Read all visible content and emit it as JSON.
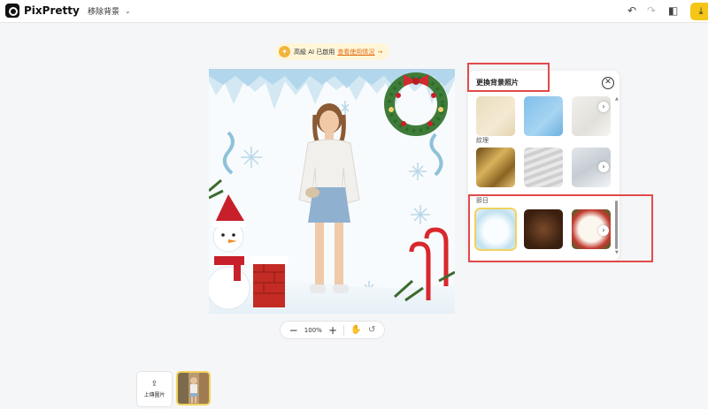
{
  "header": {
    "app_name": "PixPretty",
    "mode_label": "移除背景",
    "icons": [
      "undo-icon",
      "redo-icon",
      "compare-icon",
      "download-icon"
    ]
  },
  "promo": {
    "text": "高級 AI 已啟用",
    "link": "查看使用情況"
  },
  "zoom": {
    "value": "100%"
  },
  "panel": {
    "title": "更換背景照片",
    "sections": [
      {
        "label": "",
        "thumbs": [
          "beige-linen",
          "blue-paper",
          "white-fabric"
        ]
      },
      {
        "label": "紋理",
        "thumbs": [
          "gold-foil",
          "gray-wave",
          "white-silk"
        ]
      },
      {
        "label": "節日",
        "thumbs": [
          "snowman-frame",
          "wood-ornaments",
          "christmas-frame"
        ]
      }
    ]
  },
  "upload": {
    "label": "上傳圖片"
  },
  "colors": {
    "accent": "#f5c518",
    "highlight": "#e24a4a",
    "link": "#e2701b"
  }
}
